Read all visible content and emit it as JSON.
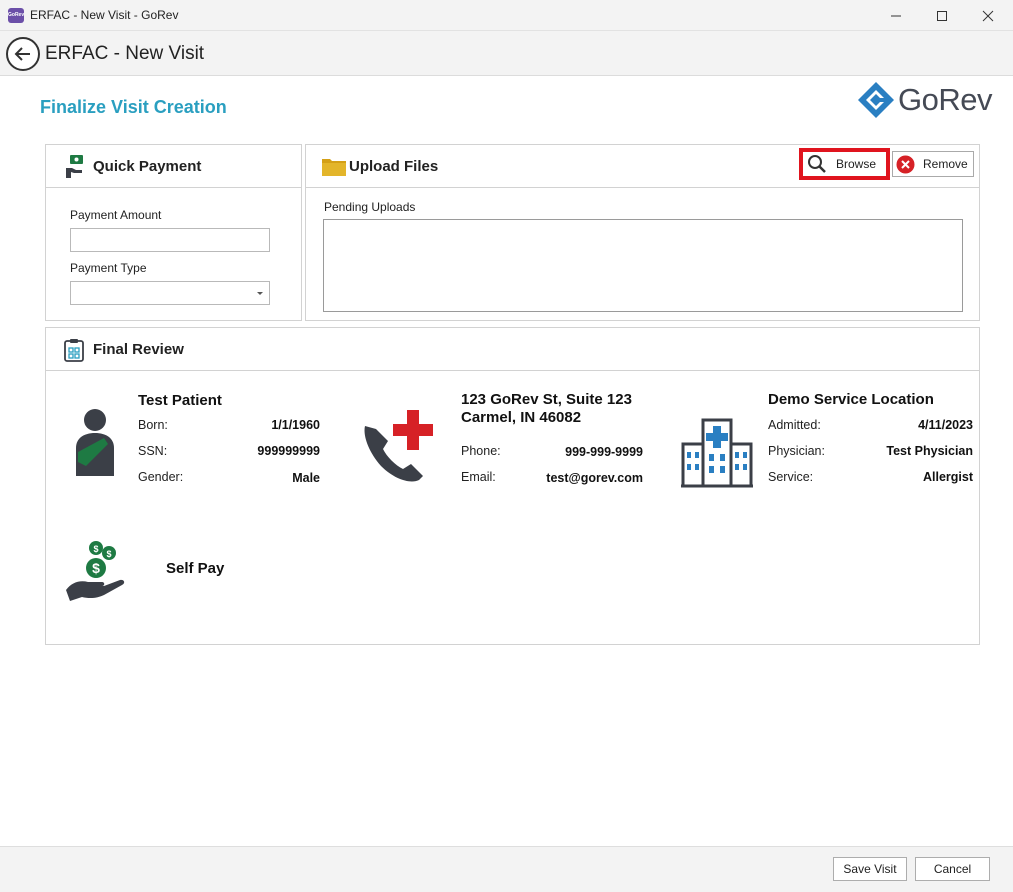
{
  "window": {
    "title": "ERFAC - New Visit - GoRev",
    "app_icon_text": "GoRev"
  },
  "nav": {
    "title": "ERFAC - New Visit"
  },
  "page": {
    "title": "Finalize Visit Creation"
  },
  "logo": {
    "text": "GoRev",
    "color": "#2a7fc2"
  },
  "quick_payment": {
    "title": "Quick Payment",
    "amount_label": "Payment Amount",
    "amount_value": "",
    "type_label": "Payment Type",
    "type_value": ""
  },
  "upload_files": {
    "title": "Upload Files",
    "browse_label": "Browse",
    "remove_label": "Remove",
    "pending_label": "Pending Uploads"
  },
  "final_review": {
    "title": "Final Review",
    "patient": {
      "name": "Test Patient",
      "born_label": "Born:",
      "born_value": "1/1/1960",
      "ssn_label": "SSN:",
      "ssn_value": "999999999",
      "gender_label": "Gender:",
      "gender_value": "Male"
    },
    "contact": {
      "address_line1": "123 GoRev St, Suite 123",
      "address_line2": "Carmel, IN 46082",
      "phone_label": "Phone:",
      "phone_value": "999-999-9999",
      "email_label": "Email:",
      "email_value": "test@gorev.com"
    },
    "location": {
      "name": "Demo Service Location",
      "admitted_label": "Admitted:",
      "admitted_value": "4/11/2023",
      "physician_label": "Physician:",
      "physician_value": "Test Physician",
      "service_label": "Service:",
      "service_value": "Allergist"
    },
    "payer": {
      "name": "Self Pay"
    }
  },
  "footer": {
    "save_label": "Save Visit",
    "cancel_label": "Cancel"
  },
  "colors": {
    "accent": "#2a9fc0",
    "highlight": "#e0141e",
    "money_green": "#1e7a43",
    "icon_dark": "#3b3f47",
    "medical_red": "#d62126",
    "hospital_blue": "#2a7fc2"
  }
}
